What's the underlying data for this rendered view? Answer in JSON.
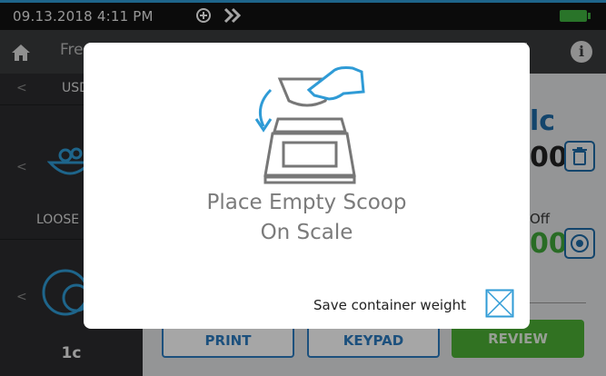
{
  "status": {
    "datetime": "09.13.2018   4:11 PM",
    "icons": [
      "bluetooth-plus-icon",
      "forward-arrows-icon"
    ],
    "battery_color": "#3fb33f"
  },
  "nav": {
    "title_partial": "Free",
    "icons": [
      "home-icon",
      "grid-icon",
      "info-icon"
    ],
    "info_label": "i"
  },
  "sidebar": {
    "section1_label": "USD",
    "section2_label": "LOOSE C",
    "section3_value": "1c",
    "chevron": "<"
  },
  "main": {
    "header_partial": "lc",
    "value1_partial": "00",
    "off_label_partial": "Off",
    "value2_partial": "00",
    "header_color": "#1e6aa6",
    "value2_color": "#3fa63a"
  },
  "buttons": {
    "print": "PRINT",
    "keypad": "KEYPAD",
    "review": "REVIEW",
    "review_color": "#4caf35"
  },
  "modal": {
    "instruction_line1": "Place Empty Scoop",
    "instruction_line2": "On Scale",
    "save_label": "Save container weight",
    "save_checked": false,
    "icon": "scoop-on-scale-icon"
  }
}
